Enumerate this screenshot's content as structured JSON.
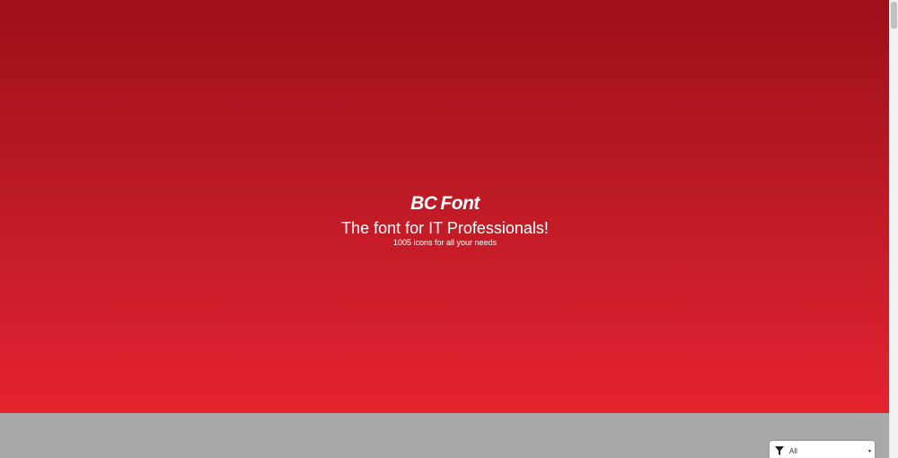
{
  "hero": {
    "logo": {
      "part1": "BC",
      "part2": "Font"
    },
    "tagline": "The font for IT Professionals!",
    "subline": "1005 icons for all your needs"
  },
  "filter": {
    "icon": "filter-icon",
    "selected": "All",
    "caret": "▾"
  },
  "colors": {
    "hero_top": "#9e0f19",
    "hero_bottom": "#e5232f",
    "page_bg": "#a9a9a9"
  }
}
